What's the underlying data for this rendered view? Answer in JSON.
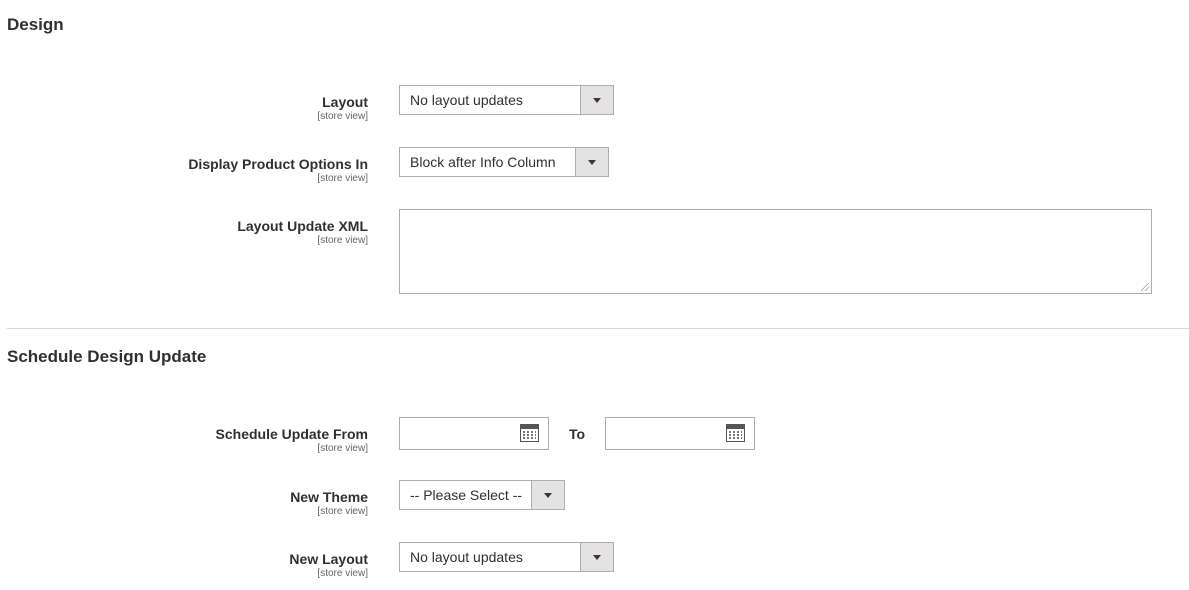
{
  "design": {
    "title": "Design",
    "layout": {
      "label": "Layout",
      "scope": "[store view]",
      "value": "No layout updates"
    },
    "display_options": {
      "label": "Display Product Options In",
      "scope": "[store view]",
      "value": "Block after Info Column"
    },
    "layout_xml": {
      "label": "Layout Update XML",
      "scope": "[store view]",
      "value": ""
    }
  },
  "schedule": {
    "title": "Schedule Design Update",
    "update_from": {
      "label": "Schedule Update From",
      "scope": "[store view]",
      "from_value": "",
      "to_label": "To",
      "to_value": ""
    },
    "new_theme": {
      "label": "New Theme",
      "scope": "[store view]",
      "value": "-- Please Select --"
    },
    "new_layout": {
      "label": "New Layout",
      "scope": "[store view]",
      "value": "No layout updates"
    }
  },
  "icons": {
    "select_arrow": "caret-down-icon",
    "calendar": "calendar-icon"
  },
  "colors": {
    "border": "#adadad",
    "button_bg": "#e3e3e3",
    "text": "#303030",
    "divider": "#d9d9d9"
  }
}
